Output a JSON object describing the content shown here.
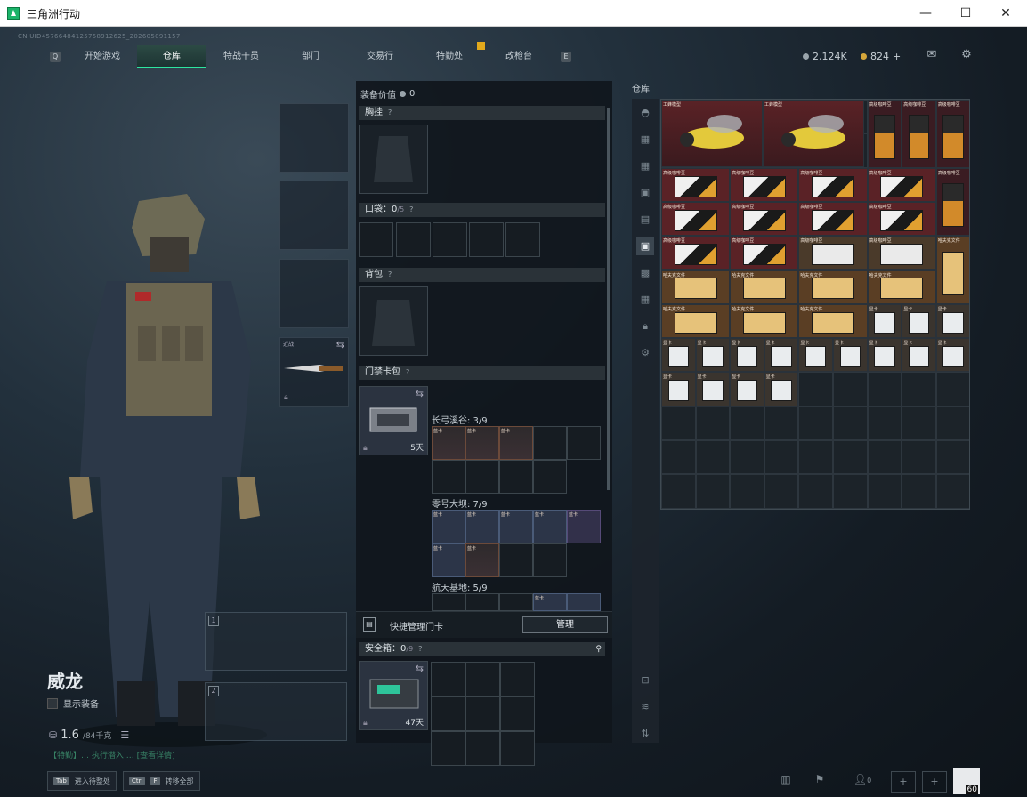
{
  "window": {
    "title": "三角洲行动",
    "min": "—",
    "max": "☐",
    "close": "✕"
  },
  "uid": "CN UID4576648412575891262​5_2026050​91157",
  "nav": {
    "left_key": "Q",
    "right_key": "E",
    "tabs": [
      "开始游戏",
      "仓库",
      "特战干员",
      "部门",
      "交易行",
      "特勤处",
      "改枪台"
    ],
    "active_tab": "仓库",
    "notice": "!"
  },
  "currency": {
    "silver": "2,124K",
    "gold": "824",
    "plus": "+"
  },
  "colors": {
    "accent": "#2ee6a0",
    "gold": "#d4a53a",
    "item_red": "#5c2a30",
    "item_orange": "#6a4a2a"
  },
  "operator": {
    "name": "威龙",
    "show_equipment": "显示装备",
    "weight": "1.6",
    "weight_max": "/84千克",
    "quote": "【特勤】… 执行潜入 … [查看详情]",
    "slot_label": "近战",
    "slot_swap": "⇆",
    "gun_slot_1": "1",
    "gun_slot_2": "2"
  },
  "equip": {
    "value_label": "装备价值",
    "value": "0",
    "chest": "胸挂",
    "pocket": "口袋：",
    "pocket_count": "0",
    "pocket_max": "/5",
    "backpack": "背包",
    "keycard_pack": "门禁卡包",
    "help": "?",
    "keycard_days": "5天",
    "maps": [
      {
        "name": "长弓溪谷: 3/9"
      },
      {
        "name": "零号大坝: 7/9"
      },
      {
        "name": "航天基地: 5/9"
      }
    ],
    "card_tags": [
      "蓝卡",
      "蓝卡",
      "蓝卡",
      "蓝卡",
      "蓝卡",
      "蓝卡",
      "蓝卡",
      "蓝卡",
      "蓝卡",
      "蓝卡",
      "蓝卡"
    ],
    "quick_manage": "快捷管理门卡",
    "manage": "管理",
    "safebox": "安全箱：",
    "safebox_count": "0",
    "safebox_max": "/9",
    "safebox_days": "47天"
  },
  "warehouse": {
    "label": "仓库",
    "item_tags": {
      "wasp": "工蜂模型",
      "coffee": "高级咖啡豆",
      "ham": "高级咖啡豆",
      "scroll": "哈夫克文件",
      "box": "显卡"
    }
  },
  "bottom": {
    "tab_key": "Tab",
    "tab_text": "进入待整处",
    "ctrl_key": "Ctrl",
    "f_key": "F",
    "f_text": "转移全部",
    "friends": "0",
    "level": "60"
  }
}
